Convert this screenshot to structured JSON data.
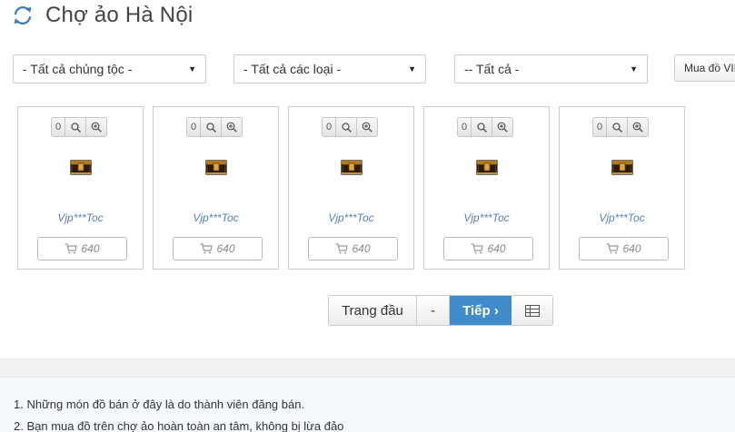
{
  "header": {
    "title": "Chợ ảo Hà Nội",
    "icon": "refresh-icon"
  },
  "filters": {
    "race": "- Tất cả chủng tộc -",
    "type": "- Tất cả các loại -",
    "status": "-- Tất cả -",
    "vip_button": "Mua đồ VIP"
  },
  "cards": [
    {
      "count": "0",
      "seller": "Vjp***Toc",
      "price": "640"
    },
    {
      "count": "0",
      "seller": "Vjp***Toc",
      "price": "640"
    },
    {
      "count": "0",
      "seller": "Vjp***Toc",
      "price": "640"
    },
    {
      "count": "0",
      "seller": "Vjp***Toc",
      "price": "640"
    },
    {
      "count": "0",
      "seller": "Vjp***Toc",
      "price": "640"
    }
  ],
  "pager": {
    "first": "Trang đầu",
    "prev": "-",
    "next": "Tiếp ›"
  },
  "notice": {
    "line1": "1. Những món đồ bán ở đây là do thành viên đăng bán.",
    "line2": "2. Bạn mua đồ trên chợ ảo hoàn toàn an tâm, không bị lừa đảo"
  },
  "colors": {
    "accent": "#428bca",
    "seller": "#5b7fb5"
  }
}
